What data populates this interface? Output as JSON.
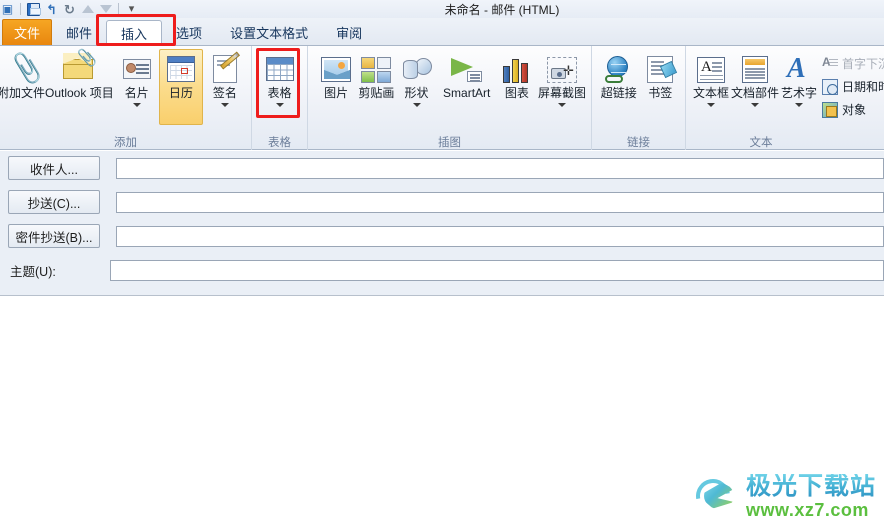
{
  "window": {
    "title": "未命名  -  邮件 (HTML)",
    "quick_access": [
      {
        "name": "outlook-icon",
        "glyph": "▣"
      },
      {
        "name": "save-icon",
        "glyph": "💾"
      },
      {
        "name": "undo-icon",
        "glyph": "↰"
      },
      {
        "name": "redo-icon",
        "glyph": "↻"
      },
      {
        "name": "move-up-icon",
        "glyph": "▲"
      },
      {
        "name": "move-down-icon",
        "glyph": "▼"
      },
      {
        "name": "customize-qat-icon",
        "glyph": "▾"
      }
    ]
  },
  "tabs": [
    {
      "label": "文件",
      "kind": "file"
    },
    {
      "label": "邮件",
      "kind": "normal"
    },
    {
      "label": "插入",
      "kind": "active"
    },
    {
      "label": "选项",
      "kind": "normal"
    },
    {
      "label": "设置文本格式",
      "kind": "normal"
    },
    {
      "label": "审阅",
      "kind": "normal"
    }
  ],
  "ribbon": {
    "groups": [
      {
        "label": "添加",
        "buttons": [
          {
            "label": "附加文件",
            "icon": "paperclip-icon",
            "caret": false,
            "selected": false
          },
          {
            "label": "Outlook 项目",
            "icon": "outlook-item-icon",
            "caret": false,
            "selected": false
          },
          {
            "label": "名片",
            "icon": "business-card-icon",
            "caret": true,
            "selected": false
          },
          {
            "label": "日历",
            "icon": "calendar-icon",
            "caret": false,
            "selected": true
          },
          {
            "label": "签名",
            "icon": "signature-icon",
            "caret": true,
            "selected": false
          }
        ]
      },
      {
        "label": "表格",
        "buttons": [
          {
            "label": "表格",
            "icon": "table-icon",
            "caret": true,
            "selected": false
          }
        ]
      },
      {
        "label": "插图",
        "buttons": [
          {
            "label": "图片",
            "icon": "picture-icon",
            "caret": false,
            "selected": false
          },
          {
            "label": "剪贴画",
            "icon": "clipart-icon",
            "caret": false,
            "selected": false
          },
          {
            "label": "形状",
            "icon": "shapes-icon",
            "caret": true,
            "selected": false
          },
          {
            "label": "SmartArt",
            "icon": "smartart-icon",
            "caret": false,
            "selected": false
          },
          {
            "label": "图表",
            "icon": "chart-icon",
            "caret": false,
            "selected": false
          },
          {
            "label": "屏幕截图",
            "icon": "screenshot-icon",
            "caret": true,
            "selected": false
          }
        ]
      },
      {
        "label": "链接",
        "buttons": [
          {
            "label": "超链接",
            "icon": "hyperlink-icon",
            "caret": false,
            "selected": false
          },
          {
            "label": "书签",
            "icon": "bookmark-icon",
            "caret": false,
            "selected": false
          }
        ]
      },
      {
        "label": "文本",
        "buttons": [
          {
            "label": "文本框",
            "icon": "textbox-icon",
            "caret": true,
            "selected": false
          },
          {
            "label": "文档部件",
            "icon": "quick-parts-icon",
            "caret": true,
            "selected": false
          },
          {
            "label": "艺术字",
            "icon": "wordart-icon",
            "caret": true,
            "selected": false
          }
        ],
        "small_buttons": [
          {
            "label": "首字下沉",
            "icon": "drop-cap-icon",
            "disabled": true
          },
          {
            "label": "日期和时间",
            "icon": "date-time-icon",
            "disabled": false
          },
          {
            "label": "对象",
            "icon": "object-icon",
            "disabled": false
          }
        ]
      }
    ]
  },
  "mail_header": {
    "rows": [
      {
        "kind": "button",
        "label": "收件人...",
        "value": "",
        "field": "to"
      },
      {
        "kind": "button",
        "label": "抄送(C)...",
        "value": "",
        "field": "cc"
      },
      {
        "kind": "button",
        "label": "密件抄送(B)...",
        "value": "",
        "field": "bcc"
      },
      {
        "kind": "label",
        "label": "主题(U):",
        "value": "",
        "field": "subject"
      }
    ]
  },
  "body": {
    "text": ""
  },
  "watermark": {
    "main": "极光下载站",
    "sub": "www.xz7.com"
  },
  "colors": {
    "file_tab": "#e8860f",
    "annotation_red": "#ee1c1c",
    "selected_button": "#fbdc8c",
    "group_label": "#6b7d99",
    "header_bg": "#eaeff6"
  }
}
